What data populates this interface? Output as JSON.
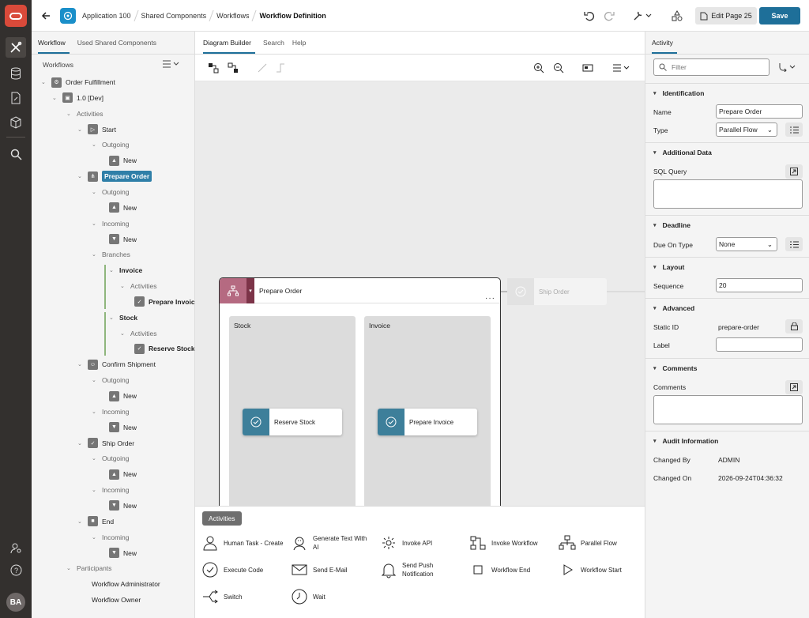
{
  "header": {
    "breadcrumbs": [
      "Application 100",
      "Shared Components",
      "Workflows",
      "Workflow Definition"
    ],
    "edit_page_label": "Edit Page 25",
    "save_label": "Save"
  },
  "user": {
    "initials": "BA"
  },
  "left_panel": {
    "tabs": [
      "Workflow",
      "Used Shared Components"
    ],
    "heading": "Workflows",
    "tree": [
      {
        "label": "Order Fulfillment",
        "level": 1,
        "icon": "workflow-icon",
        "toggle": "expanded"
      },
      {
        "label": "1.0 [Dev]",
        "level": 2,
        "icon": "version-icon",
        "toggle": "expanded"
      },
      {
        "label": "Activities",
        "level": 3,
        "group": true,
        "toggle": "expanded"
      },
      {
        "label": "Start",
        "level": 4,
        "icon": "start-icon",
        "toggle": "expanded"
      },
      {
        "label": "Outgoing",
        "level": 5,
        "group": true,
        "toggle": "expanded"
      },
      {
        "label": "New",
        "level": 6,
        "icon": "outgoing-icon"
      },
      {
        "label": "Prepare Order",
        "level": 4,
        "icon": "parallel-flow-icon",
        "toggle": "expanded",
        "selected": true
      },
      {
        "label": "Outgoing",
        "level": 5,
        "group": true,
        "toggle": "expanded"
      },
      {
        "label": "New",
        "level": 6,
        "icon": "outgoing-icon"
      },
      {
        "label": "Incoming",
        "level": 5,
        "group": true,
        "toggle": "expanded"
      },
      {
        "label": "New",
        "level": 6,
        "icon": "incoming-icon"
      },
      {
        "label": "Branches",
        "level": 5,
        "group": true,
        "toggle": "expanded"
      },
      {
        "label": "Invoice",
        "level": 6,
        "bold": true,
        "toggle": "expanded"
      },
      {
        "label": "Activities",
        "level": 7,
        "group": true,
        "toggle": "expanded"
      },
      {
        "label": "Prepare Invoice",
        "level": 8,
        "icon": "task-icon",
        "bold": true
      },
      {
        "label": "Stock",
        "level": 6,
        "bold": true,
        "toggle": "expanded"
      },
      {
        "label": "Activities",
        "level": 7,
        "group": true,
        "toggle": "expanded"
      },
      {
        "label": "Reserve Stock",
        "level": 8,
        "icon": "task-icon",
        "bold": true
      },
      {
        "label": "Confirm Shipment",
        "level": 4,
        "icon": "human-task-icon",
        "toggle": "expanded"
      },
      {
        "label": "Outgoing",
        "level": 5,
        "group": true,
        "toggle": "expanded"
      },
      {
        "label": "New",
        "level": 6,
        "icon": "outgoing-icon"
      },
      {
        "label": "Incoming",
        "level": 5,
        "group": true,
        "toggle": "expanded"
      },
      {
        "label": "New",
        "level": 6,
        "icon": "incoming-icon"
      },
      {
        "label": "Ship Order",
        "level": 4,
        "icon": "task-icon",
        "toggle": "expanded"
      },
      {
        "label": "Outgoing",
        "level": 5,
        "group": true,
        "toggle": "expanded"
      },
      {
        "label": "New",
        "level": 6,
        "icon": "outgoing-icon"
      },
      {
        "label": "Incoming",
        "level": 5,
        "group": true,
        "toggle": "expanded"
      },
      {
        "label": "New",
        "level": 6,
        "icon": "incoming-icon"
      },
      {
        "label": "End",
        "level": 4,
        "icon": "end-icon",
        "toggle": "expanded"
      },
      {
        "label": "Incoming",
        "level": 5,
        "group": true,
        "toggle": "expanded"
      },
      {
        "label": "New",
        "level": 6,
        "icon": "incoming-icon"
      },
      {
        "label": "Participants",
        "level": 3,
        "group": true,
        "toggle": "expanded"
      },
      {
        "label": "Workflow Administrator",
        "level": 5
      },
      {
        "label": "Workflow Owner",
        "level": 5
      }
    ]
  },
  "center": {
    "tabs": [
      "Diagram Builder",
      "Search",
      "Help"
    ],
    "diagram": {
      "parallel_flow": {
        "title": "Prepare Order"
      },
      "lanes": [
        {
          "title": "Stock",
          "card": "Reserve Stock"
        },
        {
          "title": "Invoice",
          "card": "Prepare Invoice"
        }
      ],
      "next_activity": "Ship Order"
    },
    "palette": {
      "tab": "Activities",
      "items": [
        {
          "label": "Human Task - Create",
          "icon": "human-task-icon"
        },
        {
          "label": "Generate Text With AI",
          "icon": "ai-icon"
        },
        {
          "label": "Invoke API",
          "icon": "api-icon"
        },
        {
          "label": "Invoke Workflow",
          "icon": "invoke-workflow-icon"
        },
        {
          "label": "Parallel Flow",
          "icon": "parallel-flow-icon"
        },
        {
          "label": "Execute Code",
          "icon": "execute-code-icon"
        },
        {
          "label": "Send E-Mail",
          "icon": "mail-icon"
        },
        {
          "label": "Send Push Notification",
          "icon": "bell-icon"
        },
        {
          "label": "Workflow End",
          "icon": "stop-icon"
        },
        {
          "label": "Workflow Start",
          "icon": "play-icon"
        },
        {
          "label": "Switch",
          "icon": "switch-icon"
        },
        {
          "label": "Wait",
          "icon": "clock-icon"
        }
      ]
    }
  },
  "right_panel": {
    "tab": "Activity",
    "filter_placeholder": "Filter",
    "sections": {
      "identification": "Identification",
      "additional_data": "Additional Data",
      "deadline": "Deadline",
      "layout": "Layout",
      "advanced": "Advanced",
      "comments": "Comments",
      "audit": "Audit Information"
    },
    "fields": {
      "name_label": "Name",
      "name_value": "Prepare Order",
      "type_label": "Type",
      "type_value": "Parallel Flow",
      "sql_label": "SQL Query",
      "due_label": "Due On Type",
      "due_value": "None",
      "sequence_label": "Sequence",
      "sequence_value": "20",
      "static_id_label": "Static ID",
      "static_id_value": "prepare-order",
      "label_label": "Label",
      "comments_label": "Comments",
      "changed_by_label": "Changed By",
      "changed_by_value": "ADMIN",
      "changed_on_label": "Changed On",
      "changed_on_value": "2026-09-24T04:36:32"
    }
  }
}
